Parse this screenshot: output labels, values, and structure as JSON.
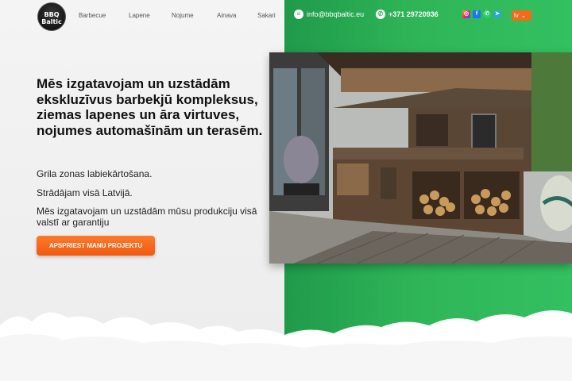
{
  "header": {
    "logo_line1": "BBQ",
    "logo_line2": "Baltic",
    "nav": [
      "Barbecue",
      "Lapene",
      "Nojume",
      "Ainava",
      "Sakari"
    ],
    "email": "info@bbqbaltic.eu",
    "phone": "+371 29720936",
    "socials": [
      "instagram-icon",
      "facebook-icon",
      "whatsapp-icon",
      "telegram-icon"
    ],
    "language": "lv"
  },
  "hero": {
    "headline": "Mēs izgatavojam un uzstādām ekskluzīvus barbekjū kompleksus, ziemas lapenes un āra virtuves, nojumes automašīnām un terasēm.",
    "line1": "Grila zonas labiekārtošana.",
    "line2": "Strādājam visā Latvijā.",
    "line3": "Mēs izgatavojam un uzstādām mūsu produkciju visā valstī ar garantiju",
    "cta": "APSPRIEST MANU PROJEKTU"
  },
  "colors": {
    "green": "#2fb558",
    "orange": "#f26a1b"
  }
}
